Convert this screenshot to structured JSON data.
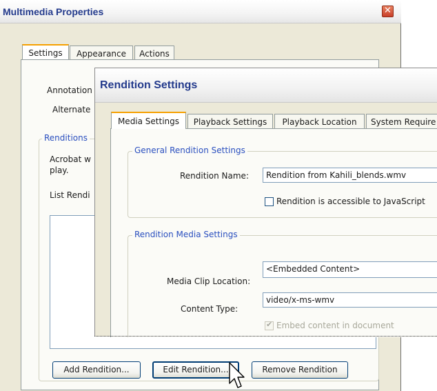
{
  "multimedia_properties": {
    "title": "Multimedia Properties",
    "close_glyph": "✕",
    "tabs": [
      {
        "label": "Settings",
        "active": true
      },
      {
        "label": "Appearance",
        "active": false
      },
      {
        "label": "Actions",
        "active": false
      }
    ],
    "annotation_label": "Annotation",
    "alternate_label": "Alternate",
    "renditions_group": "Renditions",
    "acrobat_text_1": "Acrobat w",
    "acrobat_text_2": "play.",
    "list_label": "List Rendi",
    "buttons": {
      "add": "Add Rendition...",
      "edit": "Edit Rendition...",
      "remove": "Remove Rendition"
    }
  },
  "rendition_settings": {
    "title": "Rendition Settings",
    "tabs": [
      {
        "label": "Media Settings",
        "active": true
      },
      {
        "label": "Playback Settings",
        "active": false
      },
      {
        "label": "Playback Location",
        "active": false
      },
      {
        "label": "System Require",
        "active": false
      }
    ],
    "general_group": "General Rendition Settings",
    "rendition_name_label": "Rendition Name:",
    "rendition_name_value": "Rendition from Kahili_blends.wmv",
    "js_accessible_label": "Rendition is accessible to JavaScript",
    "js_accessible_checked": false,
    "media_group": "Rendition Media Settings",
    "media_clip_label": "Media Clip Location:",
    "media_clip_value": "<Embedded Content>",
    "content_type_label": "Content Type:",
    "content_type_value": "video/x-ms-wmv",
    "embed_label": "Embed content in document",
    "embed_checked": true,
    "embed_enabled": false
  }
}
